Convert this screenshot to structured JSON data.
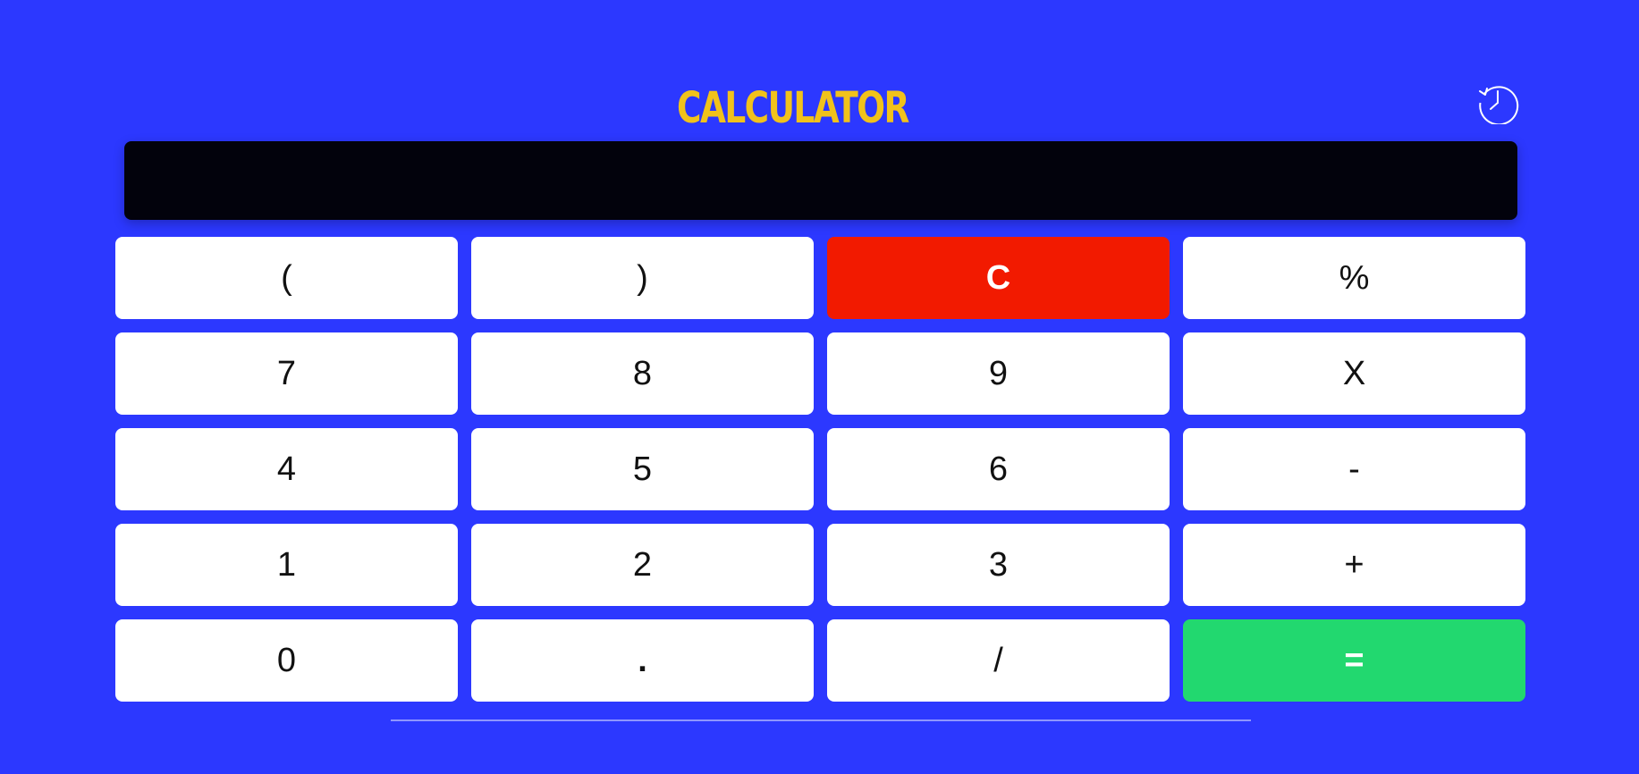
{
  "app": {
    "title": "CALCULATOR",
    "display_value": ""
  },
  "icons": {
    "history": "history-clock-icon"
  },
  "colors": {
    "background": "#2c38ff",
    "title": "#f1c21b",
    "display": "#02020c",
    "key": "#ffffff",
    "clear_key": "#f21a00",
    "equals_key": "#22d86f"
  },
  "keys": [
    {
      "label": "(",
      "name": "open-paren"
    },
    {
      "label": ")",
      "name": "close-paren"
    },
    {
      "label": "C",
      "name": "clear"
    },
    {
      "label": "%",
      "name": "percent"
    },
    {
      "label": "7",
      "name": "digit-7"
    },
    {
      "label": "8",
      "name": "digit-8"
    },
    {
      "label": "9",
      "name": "digit-9"
    },
    {
      "label": "X",
      "name": "multiply"
    },
    {
      "label": "4",
      "name": "digit-4"
    },
    {
      "label": "5",
      "name": "digit-5"
    },
    {
      "label": "6",
      "name": "digit-6"
    },
    {
      "label": "-",
      "name": "subtract"
    },
    {
      "label": "1",
      "name": "digit-1"
    },
    {
      "label": "2",
      "name": "digit-2"
    },
    {
      "label": "3",
      "name": "digit-3"
    },
    {
      "label": "+",
      "name": "add"
    },
    {
      "label": "0",
      "name": "digit-0"
    },
    {
      "label": ".",
      "name": "decimal"
    },
    {
      "label": "/",
      "name": "divide"
    },
    {
      "label": "=",
      "name": "equals"
    }
  ]
}
